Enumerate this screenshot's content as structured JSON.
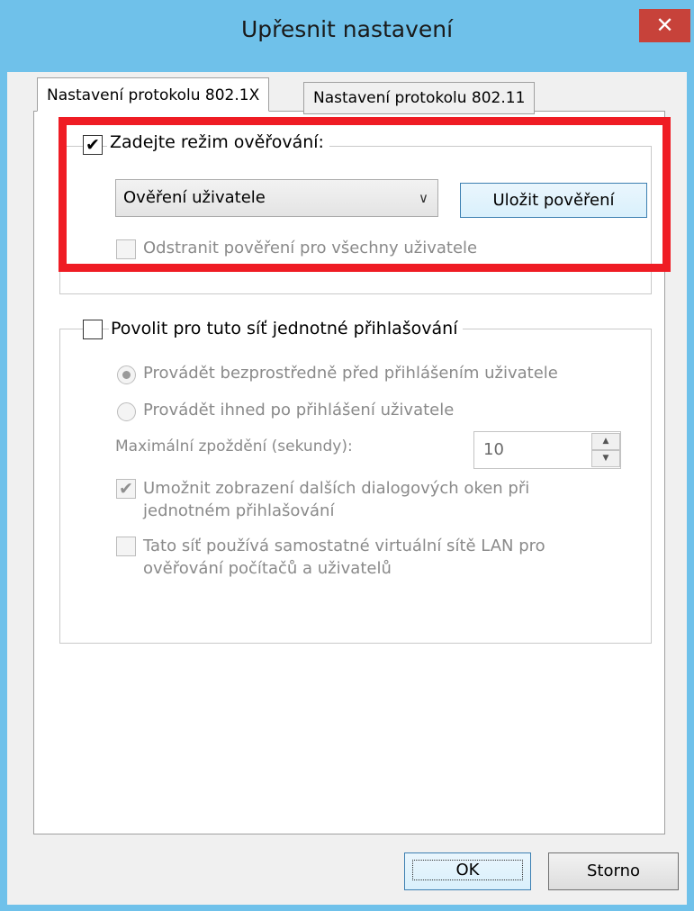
{
  "window": {
    "title": "Upřesnit nastavení",
    "close_glyph": "✕"
  },
  "tabs": [
    {
      "label": "Nastavení protokolu 802.1X",
      "active": true
    },
    {
      "label": "Nastavení protokolu 802.11",
      "active": false
    }
  ],
  "auth_group": {
    "checkbox_label": "Zadejte režim ověřování:",
    "checked": true,
    "mode_value": "Ověření uživatele",
    "save_button": "Uložit pověření",
    "delete_label": "Odstranit pověření pro všechny uživatele"
  },
  "sso_group": {
    "checkbox_label": "Povolit pro tuto síť jednotné přihlašování",
    "checked": false,
    "radio_before": "Provádět bezprostředně před přihlášením uživatele",
    "radio_after": "Provádět ihned po přihlášení uživatele",
    "delay_label": "Maximální zpoždění (sekundy):",
    "delay_value": "10",
    "dialogs_label_1": "Umožnit zobrazení dalších dialogových oken při",
    "dialogs_label_2": "jednotném přihlašování",
    "vlan_label_1": "Tato síť používá samostatné virtuální sítě LAN pro",
    "vlan_label_2": "ověřování počítačů a uživatelů"
  },
  "footer": {
    "ok": "OK",
    "cancel": "Storno"
  },
  "colors": {
    "titlebar": "#6fc1ea",
    "close": "#c7423a",
    "highlight": "#ef1c24"
  }
}
